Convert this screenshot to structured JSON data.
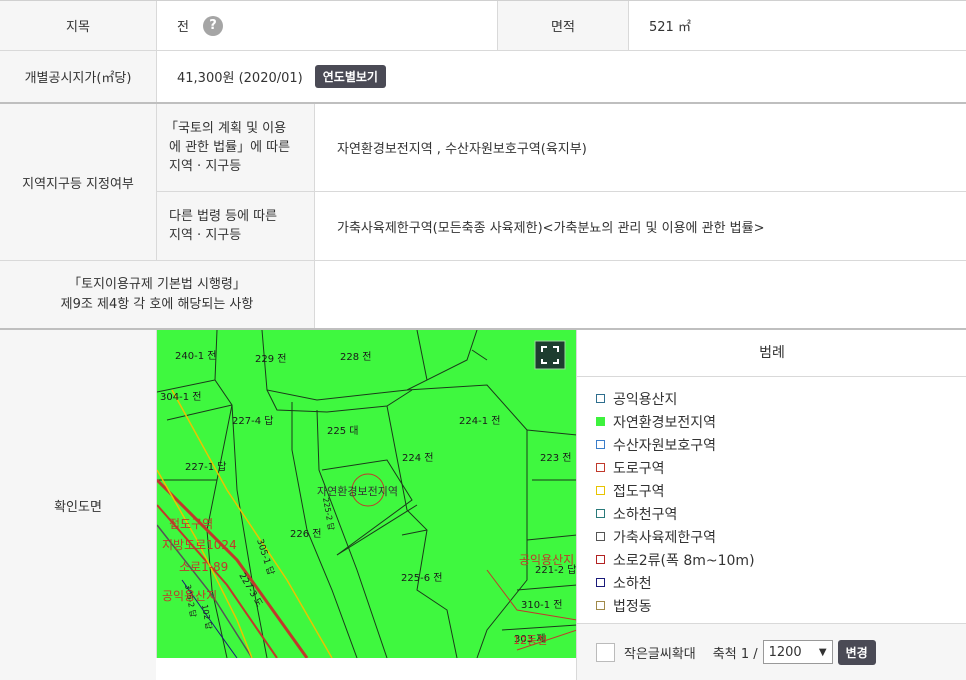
{
  "row1": {
    "jimok_label": "지목",
    "jimok_value": "전",
    "help_symbol": "?",
    "area_label": "면적",
    "area_value": "521 ㎡"
  },
  "row2": {
    "label": "개별공시지가(㎡당)",
    "value": "41,300원 (2020/01)",
    "button": "연도별보기"
  },
  "zone": {
    "label": "지역지구등 지정여부",
    "sub1_label": [
      "「국토의 계획 및 이용",
      "에 관한 법률」에 따른",
      "지역 · 지구등"
    ],
    "sub1_value": "자연환경보전지역 , 수산자원보호구역(육지부)",
    "sub2_label": [
      "다른 법령 등에 따른",
      "지역 · 지구등"
    ],
    "sub2_value": "가축사육제한구역(모든축종 사육제한)<가축분뇨의 관리 및 이용에 관한 법률>"
  },
  "decree": {
    "label": [
      "「토지이용규제 기본법 시행령」",
      "제9조 제4항 각 호에 해당되는 사항"
    ],
    "value": ""
  },
  "map_section": {
    "label": "확인도면"
  },
  "map_labels": {
    "p240_1": "240-1 전",
    "p229": "229 전",
    "p228": "228 전",
    "p304_1": "304-1 전",
    "p227_4": "227-4 답",
    "p225": "225 대",
    "p224_1": "224-1 전",
    "p224": "224 전",
    "p223": "223 전",
    "p227_1": "227-1 답",
    "p226": "226 전",
    "p305_1": "305-1 답",
    "p225_6": "225-6 전",
    "p310_1": "310-1 전",
    "p221_2": "221-2 답",
    "p225_2": "225-2 답",
    "p227_3": "227-3 도",
    "p306_2": "306-2 답",
    "p102": "102 답",
    "p303": "303 제",
    "z_nature": "자연환경보전지역",
    "z_jeopdo": "접도구역",
    "z_road": "지방도로1024",
    "z_soro": "소로1-89",
    "z_gongik": "공익용산지",
    "z_gongik2": "공익용산지",
    "z_haecheon": "12동천"
  },
  "legend": {
    "title": "범례",
    "items": [
      {
        "label": "공익용산지",
        "color": "#2e6e8e",
        "fill": ""
      },
      {
        "label": "자연환경보전지역",
        "color": "#3df23d",
        "fill": "#3df23d"
      },
      {
        "label": "수산자원보호구역",
        "color": "#3a7dc9",
        "fill": ""
      },
      {
        "label": "도로구역",
        "color": "#c0392b",
        "fill": ""
      },
      {
        "label": "접도구역",
        "color": "#e8c400",
        "fill": ""
      },
      {
        "label": "소하천구역",
        "color": "#2a7a7a",
        "fill": ""
      },
      {
        "label": "가축사육제한구역",
        "color": "#555555",
        "fill": ""
      },
      {
        "label": "소로2류(폭 8m~10m)",
        "color": "#b22222",
        "fill": ""
      },
      {
        "label": "소하천",
        "color": "#1a1a7a",
        "fill": ""
      },
      {
        "label": "법정동",
        "color": "#a08a4a",
        "fill": ""
      }
    ]
  },
  "footer": {
    "zoom_text_label": "작은글씨확대",
    "scale_label": "축척 1 /",
    "scale_value": "1200",
    "scale_options": [
      "1200"
    ],
    "change_button": "변경"
  }
}
